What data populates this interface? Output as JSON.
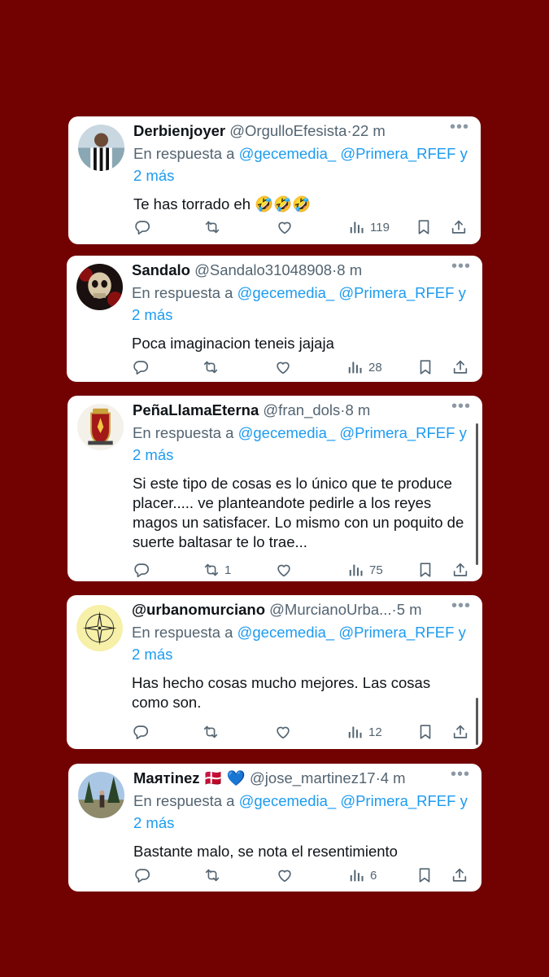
{
  "colors": {
    "background": "#720202",
    "card": "#ffffff",
    "link": "#1d9bf0",
    "muted": "#536471"
  },
  "reply_prefix": "En respuesta a",
  "reply_to": [
    "@gecemedia_",
    "@Primera_RFEF"
  ],
  "reply_suffix": "y",
  "reply_more": "2 más",
  "tweets": [
    {
      "name": "Derbienjoyer",
      "handle": "@OrgulloEfesista",
      "dot": "·",
      "time": "22 m",
      "text": "Te has torrado eh 🤣🤣🤣",
      "retweets": "",
      "views": "119",
      "avatar_icon": "person-photo-avatar"
    },
    {
      "name": "Sandalo",
      "handle": "@Sandalo31048908",
      "dot": "·",
      "time": "8 m",
      "text": "Poca imaginacion teneis jajaja",
      "retweets": "",
      "views": "28",
      "avatar_icon": "skull-avatar"
    },
    {
      "name": "PeñaLlamaEterna",
      "handle": "@fran_dols",
      "dot": "·",
      "time": "8 m",
      "text": "Si este tipo de cosas es lo único que te produce placer..... ve planteandote pedirle a los reyes magos un satisfacer. Lo mismo con un poquito de suerte baltasar te lo trae...",
      "retweets": "1",
      "views": "75",
      "avatar_icon": "crest-avatar"
    },
    {
      "name": "@urbanomurciano",
      "handle": "@MurcianoUrba...",
      "dot": "·",
      "time": "5 m",
      "text": "Has hecho cosas mucho mejores. Las cosas como son.",
      "retweets": "",
      "views": "12",
      "avatar_icon": "compass-rose-avatar"
    },
    {
      "name": "Maятinez 🇩🇰 💙",
      "handle": "@jose_martinez17",
      "dot": "·",
      "time": "4 m",
      "text": "Bastante malo, se nota el resentimiento",
      "retweets": "",
      "views": "6",
      "avatar_icon": "outdoor-photo-avatar"
    }
  ],
  "icons": [
    "more-icon",
    "reply-icon",
    "retweet-icon",
    "like-icon",
    "views-icon",
    "bookmark-icon",
    "share-icon"
  ]
}
